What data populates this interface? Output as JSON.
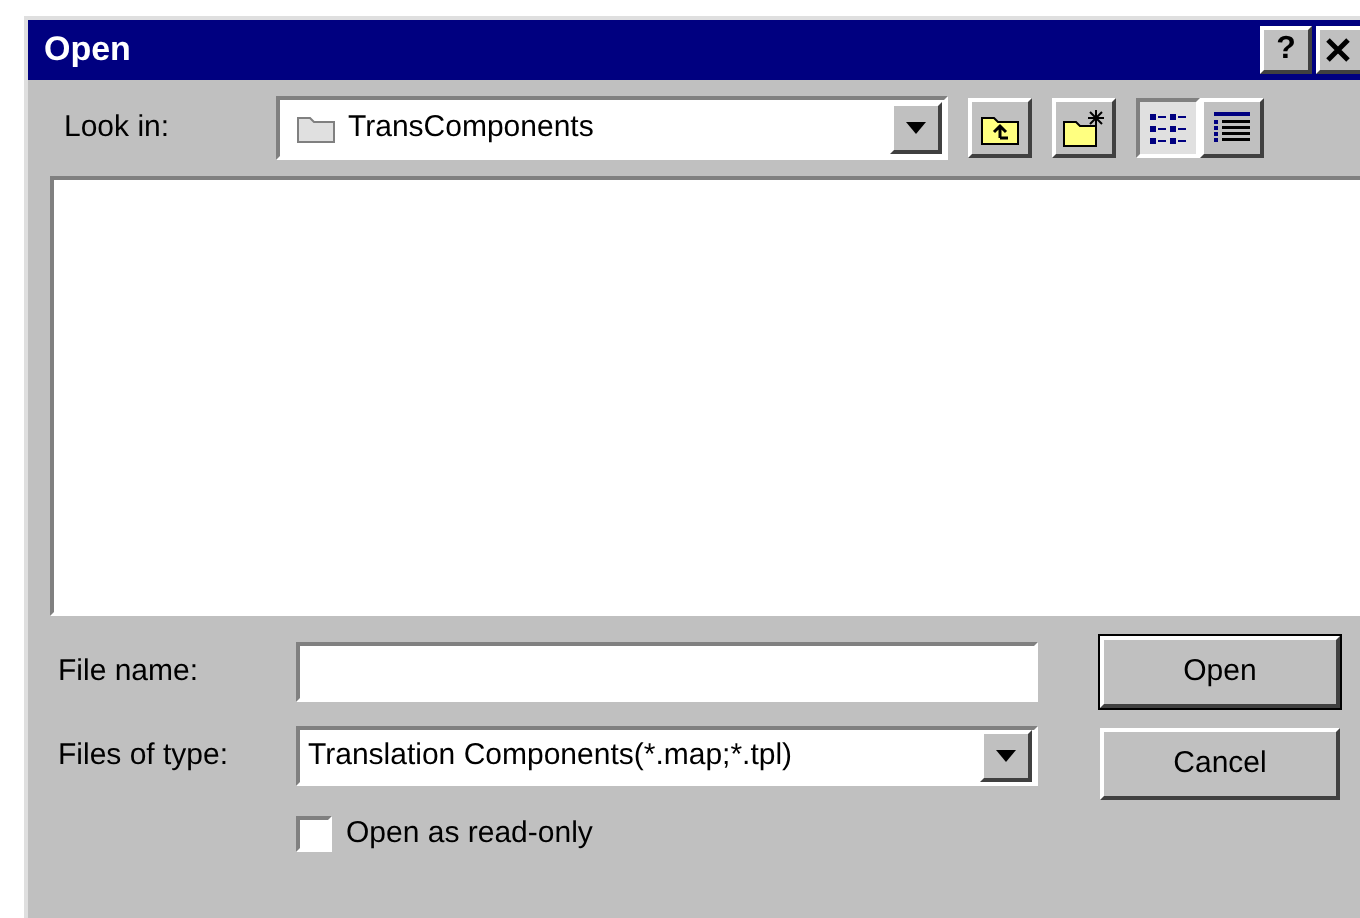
{
  "window": {
    "title": "Open",
    "help_button": "?"
  },
  "look_in": {
    "label": "Look in:",
    "value": "TransComponents"
  },
  "toolbar": [
    {
      "kind": "up"
    },
    {
      "kind": "new-folder"
    },
    {
      "kind": "list",
      "selected": true
    },
    {
      "kind": "details",
      "selected": false
    }
  ],
  "file_name": {
    "label": "File name:"
  },
  "files_of_type": {
    "label": "Files of type:",
    "value": "Translation Components(*.map;*.tpl)"
  },
  "read_only": {
    "label": "Open as read-only",
    "checked": false
  },
  "buttons": [
    {
      "label": "Open",
      "default": true
    },
    {
      "label": "Cancel",
      "default": false
    }
  ]
}
